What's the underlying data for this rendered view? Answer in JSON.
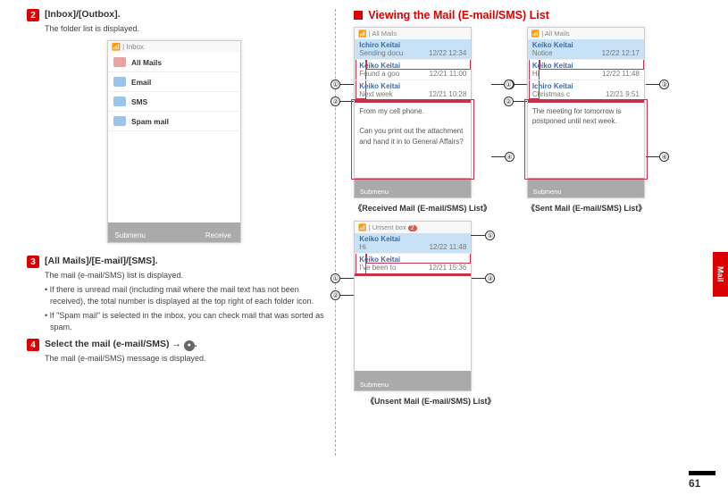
{
  "side_tab": "Mail",
  "page_number": "61",
  "left": {
    "step2": {
      "num": "2",
      "title": "[Inbox]/[Outbox].",
      "line1": "The folder list is displayed."
    },
    "phone1": {
      "status": "Inbox",
      "items": [
        {
          "label": "All Mails",
          "color": "#e7a4a4"
        },
        {
          "label": "Email",
          "color": "#9bc4e8"
        },
        {
          "label": "SMS",
          "color": "#9bc4e8"
        },
        {
          "label": "Spam mail",
          "color": "#9bc4e8"
        }
      ],
      "soft_left": "Submenu",
      "soft_right": "Receive"
    },
    "step3": {
      "num": "3",
      "title": "[All Mails]/[E-mail]/[SMS].",
      "line1": "The mail (e-mail/SMS) list is displayed.",
      "bullet1": "• If there is unread mail (including mail where the mail text has not been received), the total number is displayed at the top right of each folder icon.",
      "bullet2": "• If \"Spam mail\" is selected in the inbox, you can check mail that was sorted as spam."
    },
    "step4": {
      "num": "4",
      "title_a": "Select the mail (e-mail/SMS) → ",
      "dot": "●",
      "title_b": ".",
      "line1": "The mail (e-mail/SMS) message is displayed."
    }
  },
  "right": {
    "header": "Viewing the Mail (E-mail/SMS) List",
    "received": {
      "status": "All Mails",
      "rows": [
        {
          "name": "Ichiro Keitai",
          "sub": "Sending docu",
          "time": "12/22 12:34",
          "hl": true
        },
        {
          "name": "Keiko Keitai",
          "sub": "Found a goo",
          "time": "12/21 11:00"
        },
        {
          "name": "Keiko Keitai",
          "sub": "Next week",
          "time": "12/21 10:28"
        }
      ],
      "preview_1": "From my cell phone.",
      "preview_2": "Can you print out the attachment and hand it in to General Affairs?",
      "soft": "Submenu",
      "caption": "《Received Mail (E-mail/SMS) List》"
    },
    "sent": {
      "status": "All Mails",
      "rows": [
        {
          "name": "Keiko Keitai",
          "sub": "Notice",
          "time": "12/22 12:17",
          "hl": true
        },
        {
          "name": "Keiko Keitai",
          "sub": "Hi",
          "time": "12/22 11:48"
        },
        {
          "name": "Ichiro Keitai",
          "sub": "Christmas c",
          "time": "12/21  9:51"
        }
      ],
      "preview_1": "The meeting for tomorrow is postponed until next week.",
      "soft": "Submenu",
      "caption": "《Sent Mail (E-mail/SMS) List》"
    },
    "unsent": {
      "status": "Unsent box",
      "badge": "2",
      "rows": [
        {
          "name": "Keiko Keitai",
          "sub": "Hi",
          "time": "12/22 11:48",
          "hl": true
        },
        {
          "name": "Keiko Keitai",
          "sub": "I've been to",
          "time": "12/21 15:36"
        }
      ],
      "soft": "Submenu",
      "caption": "《Unsent Mail (E-mail/SMS) List》"
    },
    "callouts": {
      "c1": "①",
      "c2": "②",
      "c3": "③",
      "c4": "④",
      "c5": "⑤"
    }
  }
}
